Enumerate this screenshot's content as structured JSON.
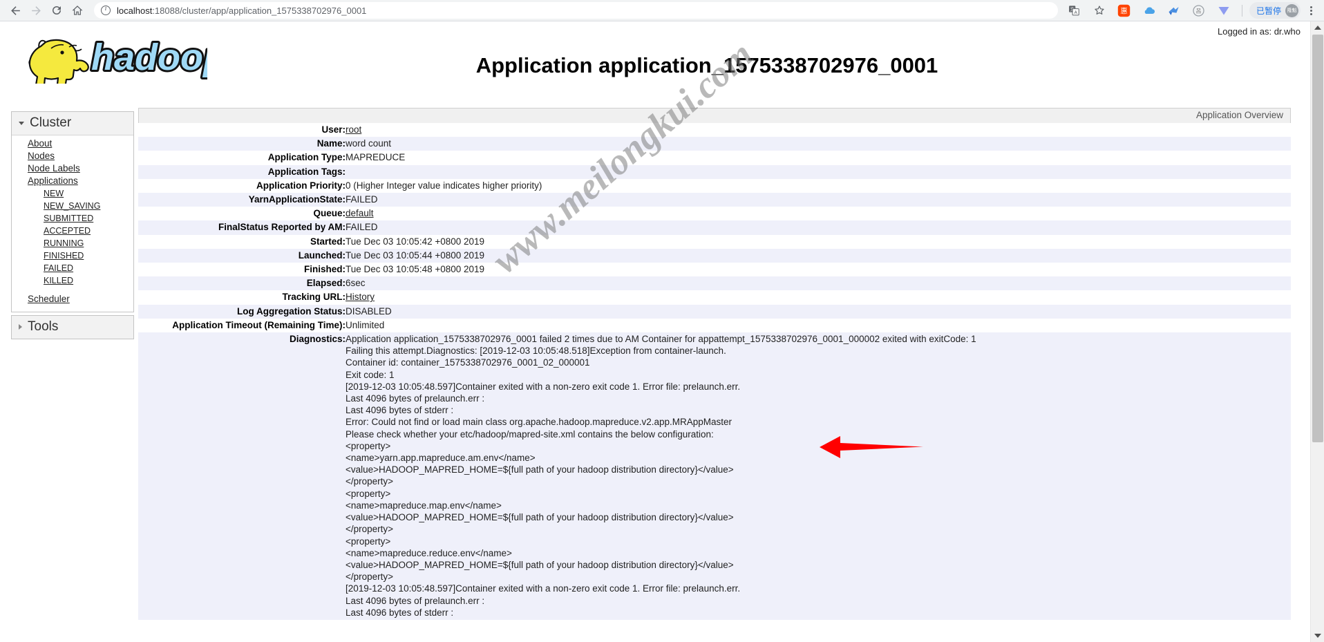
{
  "browser": {
    "back_icon": "back-arrow",
    "forward_icon": "forward-arrow",
    "reload_icon": "reload",
    "home_icon": "home",
    "url_scheme_host": "localhost",
    "url_rest": ":18088/cluster/app/application_1575338702976_0001",
    "url_full": "localhost:18088/cluster/app/application_1575338702976_0001",
    "translate_icon": "translate-icon",
    "bookmark_icon": "star-icon",
    "extensions": [
      {
        "name": "taobao-coupon-extension",
        "glyph": "惠"
      },
      {
        "name": "cloud-extension",
        "glyph": "☁"
      },
      {
        "name": "bird-extension",
        "glyph": "✈"
      },
      {
        "name": "tools-extension",
        "glyph": "呂"
      },
      {
        "name": "video-downloader-extension",
        "glyph": "▼"
      }
    ],
    "profile_paused_label": "已暂停",
    "profile_avatar_label": "隆魁",
    "menu_icon": "kebab-menu-icon"
  },
  "page": {
    "logged_in": "Logged in as: dr.who",
    "title": "Application application_1575338702976_0001",
    "watermark": "www.meilongkui.com",
    "logo_alt": "hadoop-logo",
    "overview_label": "Application Overview"
  },
  "sidebar": {
    "cluster": {
      "title": "Cluster",
      "links": [
        {
          "label": "About",
          "name": "sidebar-item-about",
          "sub": false
        },
        {
          "label": "Nodes",
          "name": "sidebar-item-nodes",
          "sub": false
        },
        {
          "label": "Node Labels",
          "name": "sidebar-item-node-labels",
          "sub": false
        },
        {
          "label": "Applications",
          "name": "sidebar-item-applications",
          "sub": false
        },
        {
          "label": "NEW",
          "name": "sidebar-item-new",
          "sub": true
        },
        {
          "label": "NEW_SAVING",
          "name": "sidebar-item-new-saving",
          "sub": true
        },
        {
          "label": "SUBMITTED",
          "name": "sidebar-item-submitted",
          "sub": true
        },
        {
          "label": "ACCEPTED",
          "name": "sidebar-item-accepted",
          "sub": true
        },
        {
          "label": "RUNNING",
          "name": "sidebar-item-running",
          "sub": true
        },
        {
          "label": "FINISHED",
          "name": "sidebar-item-finished",
          "sub": true
        },
        {
          "label": "FAILED",
          "name": "sidebar-item-failed",
          "sub": true
        },
        {
          "label": "KILLED",
          "name": "sidebar-item-killed",
          "sub": true
        }
      ],
      "scheduler_label": "Scheduler"
    },
    "tools": {
      "title": "Tools"
    }
  },
  "application": {
    "rows": [
      {
        "label": "User:",
        "value": "root",
        "link": true
      },
      {
        "label": "Name:",
        "value": "word count",
        "link": false
      },
      {
        "label": "Application Type:",
        "value": "MAPREDUCE",
        "link": false
      },
      {
        "label": "Application Tags:",
        "value": "",
        "link": false
      },
      {
        "label": "Application Priority:",
        "value": "0 (Higher Integer value indicates higher priority)",
        "link": false
      },
      {
        "label": "YarnApplicationState:",
        "value": "FAILED",
        "link": false
      },
      {
        "label": "Queue:",
        "value": "default",
        "link": true
      },
      {
        "label": "FinalStatus Reported by AM:",
        "value": "FAILED",
        "link": false
      },
      {
        "label": "Started:",
        "value": "Tue Dec 03 10:05:42 +0800 2019",
        "link": false
      },
      {
        "label": "Launched:",
        "value": "Tue Dec 03 10:05:44 +0800 2019",
        "link": false
      },
      {
        "label": "Finished:",
        "value": "Tue Dec 03 10:05:48 +0800 2019",
        "link": false
      },
      {
        "label": "Elapsed:",
        "value": "6sec",
        "link": false
      },
      {
        "label": "Tracking URL:",
        "value": "History",
        "link": true
      },
      {
        "label": "Log Aggregation Status:",
        "value": "DISABLED",
        "link": false
      },
      {
        "label": "Application Timeout (Remaining Time):",
        "value": "Unlimited",
        "link": false
      }
    ],
    "diagnostics_label": "Diagnostics:",
    "diagnostics": "Application application_1575338702976_0001 failed 2 times due to AM Container for appattempt_1575338702976_0001_000002 exited with exitCode: 1\nFailing this attempt.Diagnostics: [2019-12-03 10:05:48.518]Exception from container-launch.\nContainer id: container_1575338702976_0001_02_000001\nExit code: 1\n[2019-12-03 10:05:48.597]Container exited with a non-zero exit code 1. Error file: prelaunch.err.\nLast 4096 bytes of prelaunch.err :\nLast 4096 bytes of stderr :\nError: Could not find or load main class org.apache.hadoop.mapreduce.v2.app.MRAppMaster\nPlease check whether your etc/hadoop/mapred-site.xml contains the below configuration:\n<property>\n<name>yarn.app.mapreduce.am.env</name>\n<value>HADOOP_MAPRED_HOME=${full path of your hadoop distribution directory}</value>\n</property>\n<property>\n<name>mapreduce.map.env</name>\n<value>HADOOP_MAPRED_HOME=${full path of your hadoop distribution directory}</value>\n</property>\n<property>\n<name>mapreduce.reduce.env</name>\n<value>HADOOP_MAPRED_HOME=${full path of your hadoop distribution directory}</value>\n</property>\n[2019-12-03 10:05:48.597]Container exited with a non-zero exit code 1. Error file: prelaunch.err.\nLast 4096 bytes of prelaunch.err :\nLast 4096 bytes of stderr :"
  },
  "annotation": {
    "arrow_color": "#ff0000",
    "arrow_name": "red-arrow-pointing-to-error-line"
  },
  "colors": {
    "row_alt": "#eff0fa",
    "panel_header": "#f2f2f2",
    "accent_blue": "#1a73e8"
  }
}
